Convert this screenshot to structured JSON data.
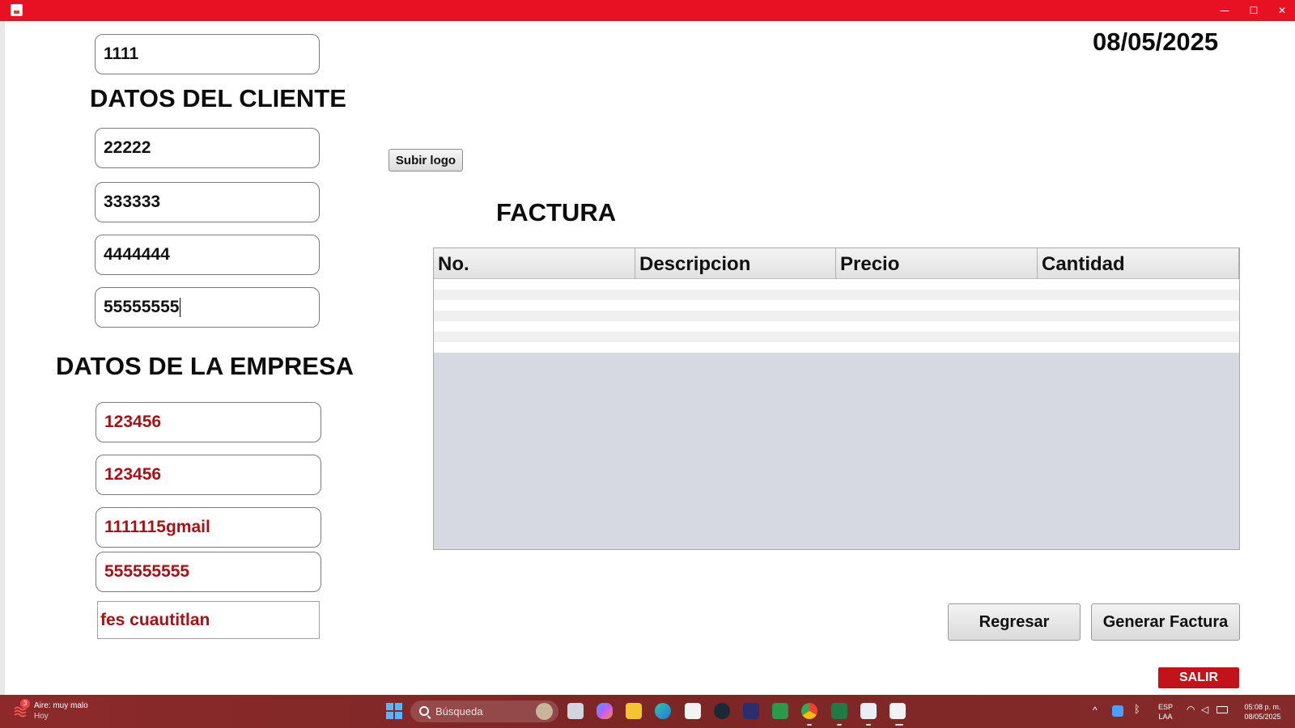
{
  "window": {
    "minimize_glyph": "—",
    "maximize_glyph": "☐",
    "close_glyph": "✕"
  },
  "date": "08/05/2025",
  "top_field": "1111",
  "cliente": {
    "heading": "DATOS DEL CLIENTE",
    "fields": [
      "22222",
      "333333",
      "4444444",
      "55555555"
    ]
  },
  "empresa": {
    "heading": "DATOS DE LA EMPRESA",
    "fields": [
      "123456",
      "123456",
      "1111115gmail",
      "555555555",
      "fes cuautitlan"
    ]
  },
  "upload_logo_button": "Subir logo",
  "invoice": {
    "title": "FACTURA",
    "columns": [
      "No.",
      "Descripcion",
      "Precio",
      "Cantidad"
    ],
    "empty_rows": 7
  },
  "buttons": {
    "back": "Regresar",
    "generate": "Generar Factura",
    "exit": "SALIR"
  },
  "taskbar": {
    "weather_badge": "3",
    "weather_title": "Aire: muy malo",
    "weather_sub": "Hoy",
    "search_placeholder": "Búsqueda",
    "language_top": "ESP",
    "language_bottom": "LAA",
    "time": "05:08 p. m.",
    "date": "08/05/2025",
    "accent": "#8a2b2b"
  },
  "colors": {
    "titlebar": "#e81123",
    "company_text": "#a51217",
    "exit_button": "#c4121a",
    "table_empty": "#d6d9e0"
  }
}
